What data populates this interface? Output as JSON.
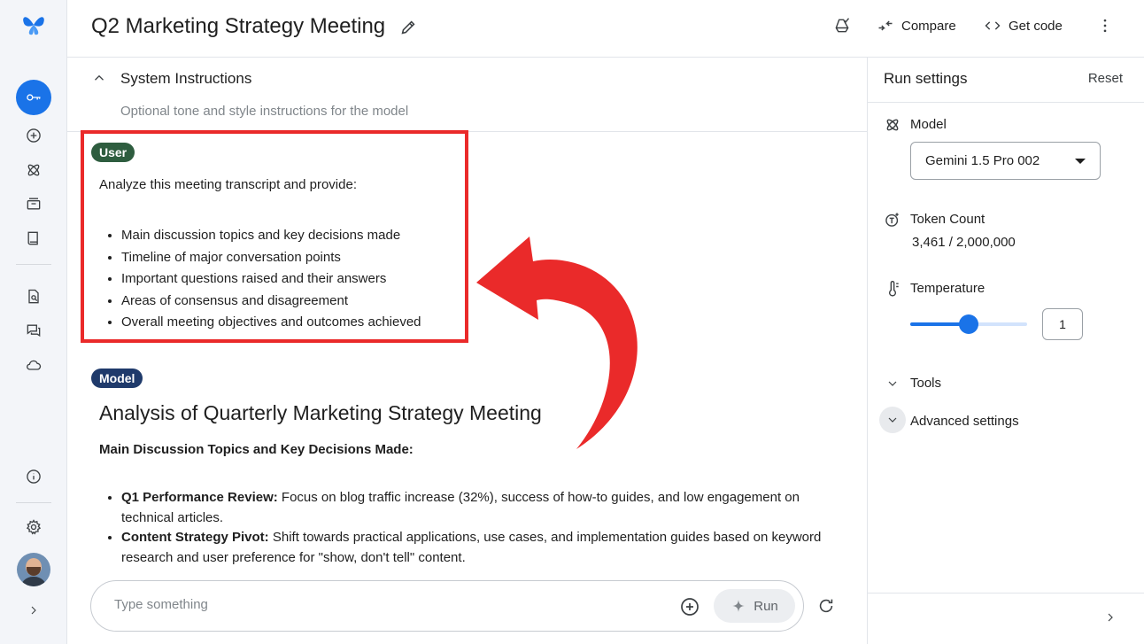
{
  "header": {
    "title": "Q2 Marketing Strategy Meeting",
    "compare_label": "Compare",
    "get_code_label": "Get code"
  },
  "system_instructions": {
    "title": "System Instructions",
    "placeholder": "Optional tone and style instructions for the model"
  },
  "user_turn": {
    "role": "User",
    "prompt": "Analyze this meeting transcript and provide:",
    "items": [
      "Main discussion topics and key decisions made",
      "Timeline of major conversation points",
      "Important questions raised and their answers",
      "Areas of consensus and disagreement",
      "Overall meeting objectives and outcomes achieved"
    ]
  },
  "model_turn": {
    "role": "Model",
    "title": "Analysis of Quarterly Marketing Strategy Meeting",
    "subtitle": "Main Discussion Topics and Key Decisions Made:",
    "items": [
      {
        "bold": "Q1 Performance Review:",
        "text": " Focus on blog traffic increase (32%), success of how-to guides, and low engagement on technical articles."
      },
      {
        "bold": "Content Strategy Pivot:",
        "text": " Shift towards practical applications, use cases, and implementation guides based on keyword research and user preference for \"show, don't tell\" content."
      }
    ]
  },
  "composer": {
    "placeholder": "Type something",
    "run_label": "Run"
  },
  "settings": {
    "title": "Run settings",
    "reset_label": "Reset",
    "model_label": "Model",
    "model_value": "Gemini 1.5 Pro 002",
    "token_label": "Token Count",
    "token_value": "3,461 / 2,000,000",
    "temperature_label": "Temperature",
    "temperature_value": "1",
    "temperature_fraction": 0.5,
    "tools_label": "Tools",
    "advanced_label": "Advanced settings"
  },
  "colors": {
    "accent": "#1a73e8",
    "user_chip": "#2e5d3f",
    "model_chip": "#1f3a6b",
    "highlight": "#ea2a2a"
  }
}
